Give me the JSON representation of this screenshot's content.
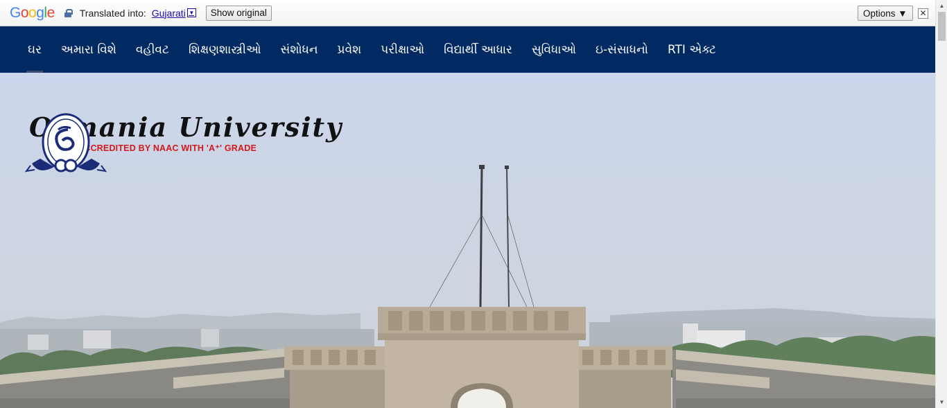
{
  "translate_bar": {
    "logo": "Google",
    "translated_label": "Translated into:",
    "language": "Gujarati",
    "show_original": "Show original",
    "options": "Options ▼",
    "close": "✕"
  },
  "nav": {
    "items": [
      {
        "label": "ઘર"
      },
      {
        "label": "અમારા વિશે"
      },
      {
        "label": "વહીવટ"
      },
      {
        "label": "શિક્ષણશાસ્ત્રીઓ"
      },
      {
        "label": "સંશોધન"
      },
      {
        "label": "પ્રવેશ"
      },
      {
        "label": "પરીક્ષાઓ"
      },
      {
        "label": "વિદ્યાર્થી આધાર"
      },
      {
        "label": "સુવિધાઓ"
      },
      {
        "label": "ઇ-સંસાધનો"
      },
      {
        "label": "RTI એક્ટ"
      }
    ]
  },
  "hero": {
    "university_name": "Osmania University",
    "accreditation": "ACCREDITED BY NAAC WITH 'A⁺' GRADE"
  },
  "colors": {
    "nav_bg": "#012a62",
    "accent_red": "#d21a1a"
  }
}
